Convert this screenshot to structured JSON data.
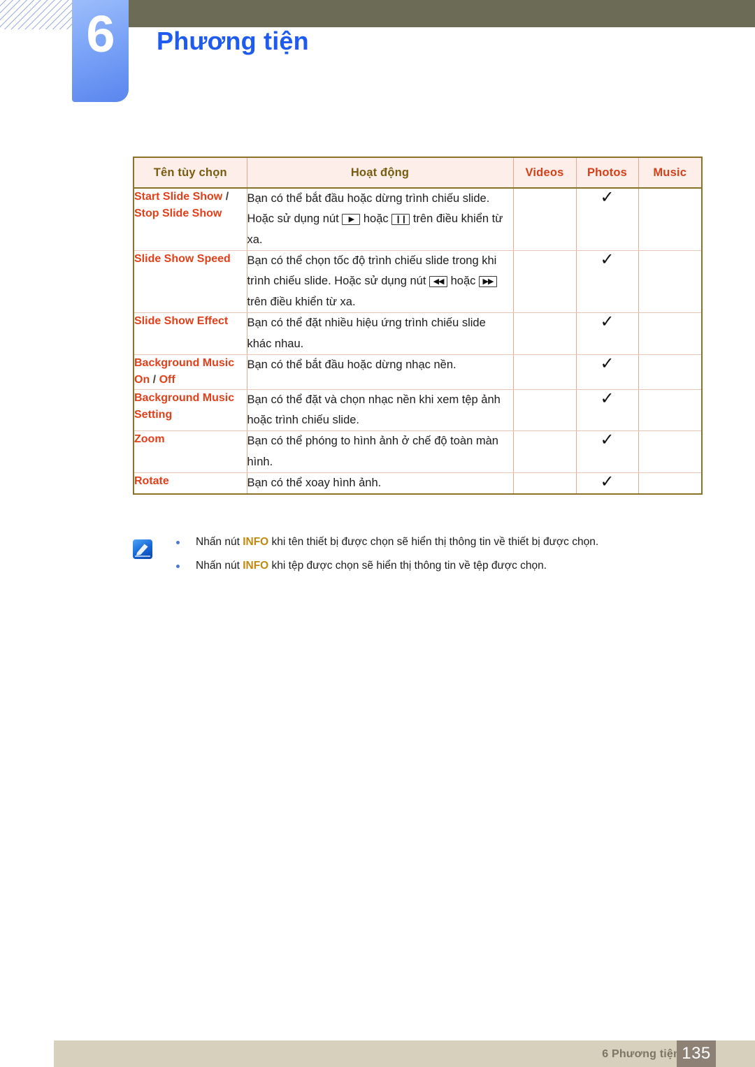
{
  "header": {
    "chapter_number": "6",
    "chapter_title": "Phương tiện"
  },
  "table": {
    "columns": [
      {
        "label": "Tên tùy chọn",
        "style": "olive"
      },
      {
        "label": "Hoạt động",
        "style": "olive"
      },
      {
        "label": "Videos",
        "style": "red"
      },
      {
        "label": "Photos",
        "style": "red"
      },
      {
        "label": "Music",
        "style": "red"
      }
    ],
    "rows": [
      {
        "option_parts": [
          {
            "text": "Start Slide Show",
            "kind": "name"
          },
          {
            "text": " / ",
            "kind": "sep"
          },
          {
            "text": "Stop Slide Show",
            "kind": "name"
          }
        ],
        "option_plain": "Start Slide Show / Stop Slide Show",
        "desc_prefix": "Bạn có thể bắt đầu hoặc dừng trình chiếu slide. Hoặc sử dụng nút ",
        "key1": "▶",
        "desc_mid": " hoặc ",
        "key2": "❙❙",
        "desc_suffix": " trên điều khiển từ xa.",
        "videos": "",
        "photos": "✓",
        "music": ""
      },
      {
        "option_parts": [
          {
            "text": "Slide Show Speed",
            "kind": "name"
          }
        ],
        "option_plain": "Slide Show Speed",
        "desc_prefix": "Bạn có thể chọn tốc độ trình chiếu slide trong khi trình chiếu slide. Hoặc sử dụng nút ",
        "key1": "◀◀",
        "desc_mid": " hoặc ",
        "key2": "▶▶",
        "desc_suffix": " trên điều khiển từ xa.",
        "videos": "",
        "photos": "✓",
        "music": ""
      },
      {
        "option_parts": [
          {
            "text": "Slide Show Effect",
            "kind": "name"
          }
        ],
        "option_plain": "Slide Show Effect",
        "desc_prefix": "Bạn có thể đặt nhiều hiệu ứng trình chiếu slide khác nhau.",
        "key1": "",
        "desc_mid": "",
        "key2": "",
        "desc_suffix": "",
        "videos": "",
        "photos": "✓",
        "music": ""
      },
      {
        "option_parts": [
          {
            "text": "Background Music On",
            "kind": "name"
          },
          {
            "text": " / ",
            "kind": "sep"
          },
          {
            "text": "Off",
            "kind": "name"
          }
        ],
        "option_plain": "Background Music On / Off",
        "desc_prefix": "Bạn có thể bắt đầu hoặc dừng nhạc nền.",
        "key1": "",
        "desc_mid": "",
        "key2": "",
        "desc_suffix": "",
        "videos": "",
        "photos": "✓",
        "music": ""
      },
      {
        "option_parts": [
          {
            "text": "Background Music Setting",
            "kind": "name"
          }
        ],
        "option_plain": "Background Music Setting",
        "desc_prefix": "Bạn có thể đặt và chọn nhạc nền khi xem tệp ảnh hoặc trình chiếu slide.",
        "key1": "",
        "desc_mid": "",
        "key2": "",
        "desc_suffix": "",
        "videos": "",
        "photos": "✓",
        "music": ""
      },
      {
        "option_parts": [
          {
            "text": "Zoom",
            "kind": "name"
          }
        ],
        "option_plain": "Zoom",
        "desc_prefix": "Bạn có thể phóng to hình ảnh ở chế độ toàn màn hình.",
        "key1": "",
        "desc_mid": "",
        "key2": "",
        "desc_suffix": "",
        "videos": "",
        "photos": "✓",
        "music": ""
      },
      {
        "option_parts": [
          {
            "text": "Rotate",
            "kind": "name"
          }
        ],
        "option_plain": "Rotate",
        "desc_prefix": "Bạn có thể xoay hình ảnh.",
        "key1": "",
        "desc_mid": "",
        "key2": "",
        "desc_suffix": "",
        "videos": "",
        "photos": "✓",
        "music": ""
      }
    ]
  },
  "note": {
    "icon_name": "note-pencil-icon",
    "items": [
      {
        "prefix": "Nhấn nút ",
        "emphasis": "INFO",
        "suffix": " khi tên thiết bị được chọn sẽ hiển thị thông tin về thiết bị được chọn."
      },
      {
        "prefix": "Nhấn nút ",
        "emphasis": "INFO",
        "suffix": " khi tệp được chọn sẽ hiển thị thông tin về tệp được chọn."
      }
    ]
  },
  "footer": {
    "text": "6 Phương tiện",
    "page_number": "135"
  },
  "colors": {
    "chapter_title": "#1f5bef",
    "olive_bar": "#6b6b56",
    "header_olive_text": "#7a5c10",
    "header_red_text": "#d3401a",
    "option_text": "#e0401a",
    "table_border_outer": "#8a7226",
    "table_border_inner": "#e8a88d",
    "header_bg": "#fdeeea",
    "footer_bar": "#d6d0bd",
    "footer_page_bg": "#8d8175",
    "note_emphasis": "#c08a10"
  }
}
